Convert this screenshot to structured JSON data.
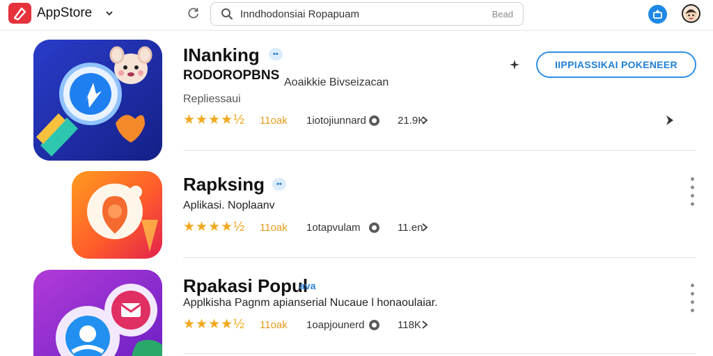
{
  "header": {
    "brand": "AppStore",
    "search_query": "Inndhodonsiai Ropapuam",
    "search_button": "Bead"
  },
  "apps": [
    {
      "title": "INanking",
      "badge": "••",
      "subtitle_a": "RODOROPBNS",
      "subtitle_b": "Aoaikkie  Bivseizacan",
      "description": "Repliessaui",
      "stars": "★★★★½",
      "rating": "11oak",
      "downloads": "1iotojiunnard",
      "size": "21.9K",
      "install_label": "IIPPIASSIKAI POKENEER"
    },
    {
      "title": "Rapksing",
      "badge": "••",
      "description": "Aplikasi. Noplaanv",
      "stars": "★★★★½",
      "rating": "11oak",
      "downloads": "1otapvulam",
      "size": "11.en"
    },
    {
      "title": "Rpakasi Popul",
      "badge": "ava",
      "description": "Applkisha Pagnm apianserial Nucaue l honaoulaiar.",
      "stars": "★★★★½",
      "rating": "11oak",
      "downloads": "1oapjounerd",
      "size": "118K"
    }
  ],
  "colors": {
    "brand_red": "#e5323b",
    "accent_blue": "#2c8fe6",
    "star_gold": "#f2a81d"
  },
  "icons": [
    "appstore-logo-icon",
    "chevron-down-icon",
    "refresh-icon",
    "search-icon",
    "notification-icon",
    "avatar",
    "share-icon",
    "more-vertical-icon",
    "chevron-right-icon",
    "download-icon"
  ]
}
